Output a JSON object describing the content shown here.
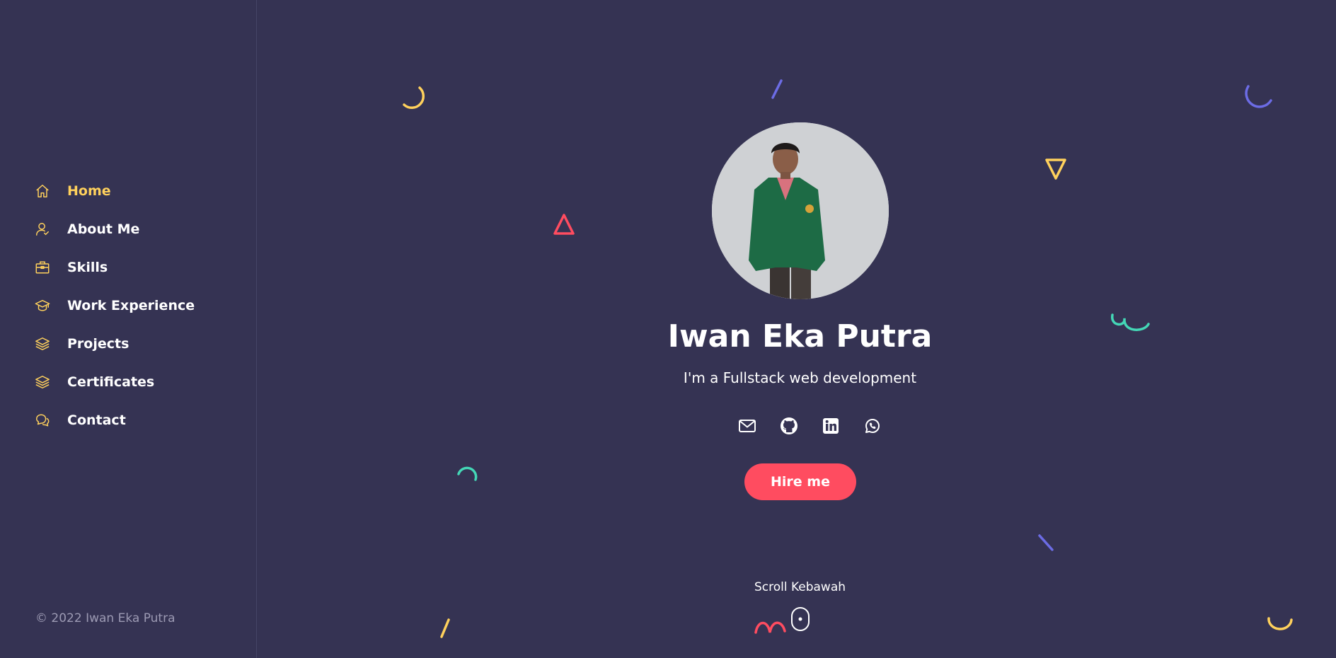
{
  "sidebar": {
    "items": [
      {
        "label": "Home",
        "icon": "home-icon",
        "active": true
      },
      {
        "label": "About Me",
        "icon": "user-check-icon",
        "active": false
      },
      {
        "label": "Skills",
        "icon": "briefcase-icon",
        "active": false
      },
      {
        "label": "Work Experience",
        "icon": "graduation-cap-icon",
        "active": false
      },
      {
        "label": "Projects",
        "icon": "layers-icon",
        "active": false
      },
      {
        "label": "Certificates",
        "icon": "layers-icon",
        "active": false
      },
      {
        "label": "Contact",
        "icon": "chat-bubbles-icon",
        "active": false
      }
    ],
    "copyright": "© 2022 Iwan Eka Putra"
  },
  "hero": {
    "name": "Iwan Eka Putra",
    "tagline": "I'm a Fullstack web development",
    "socials": [
      "envelope-icon",
      "github-icon",
      "linkedin-icon",
      "whatsapp-icon"
    ],
    "hire_label": "Hire me",
    "scroll_label": "Scroll Kebawah"
  },
  "colors": {
    "background": "#353353",
    "accent_yellow": "#FFD15C",
    "accent_red": "#FF4C60",
    "accent_purple": "#6C6CE5",
    "accent_green": "#44D7B6",
    "muted_text": "#9C9AB3"
  }
}
